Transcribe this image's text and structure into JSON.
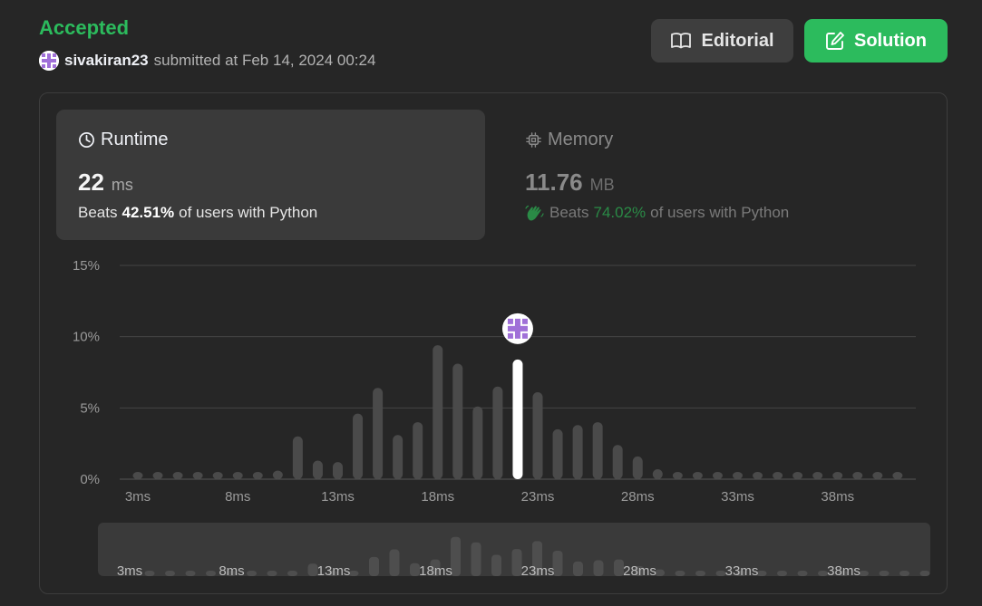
{
  "submission": {
    "status": "Accepted",
    "username": "sivakiran23",
    "submitted_text": "submitted at Feb 14, 2024 00:24"
  },
  "buttons": {
    "editorial": "Editorial",
    "solution": "Solution"
  },
  "runtime": {
    "label": "Runtime",
    "value": "22",
    "unit": "ms",
    "beats_prefix": "Beats",
    "beats_pct": "42.51%",
    "beats_suffix": "of users with Python"
  },
  "memory": {
    "label": "Memory",
    "value": "11.76",
    "unit": "MB",
    "beats_prefix": "Beats",
    "beats_pct": "74.02%",
    "beats_suffix": "of users with Python"
  },
  "colors": {
    "accent_green": "#2cbb5d",
    "bar": "#4a4a4a",
    "bar_selected": "#ffffff",
    "avatar": "#a070d8"
  },
  "chart_data": {
    "type": "bar",
    "ylabel": "",
    "xlabel": "",
    "y_ticks": [
      "15%",
      "10%",
      "5%",
      "0%"
    ],
    "ylim": [
      0,
      15
    ],
    "x_tick_labels": [
      "3ms",
      "8ms",
      "13ms",
      "18ms",
      "23ms",
      "28ms",
      "33ms",
      "38ms"
    ],
    "x": [
      3,
      4,
      5,
      6,
      7,
      8,
      9,
      10,
      11,
      12,
      13,
      14,
      15,
      16,
      17,
      18,
      19,
      20,
      21,
      22,
      23,
      24,
      25,
      26,
      27,
      28,
      29,
      30,
      31,
      32,
      33,
      34,
      35,
      36,
      37,
      38,
      39,
      40,
      41
    ],
    "values": [
      0.3,
      0.3,
      0.3,
      0.3,
      0.4,
      0.3,
      0.3,
      0.6,
      3.0,
      1.3,
      1.2,
      4.6,
      6.4,
      3.1,
      4.0,
      9.4,
      8.1,
      5.1,
      6.5,
      8.4,
      6.1,
      3.5,
      3.8,
      4.0,
      2.4,
      1.6,
      0.7,
      0.4,
      0.3,
      0.3,
      0.3,
      0.3,
      0.3,
      0.3,
      0.3,
      0.3,
      0.3,
      0.3,
      0.3
    ],
    "selected_x": 22,
    "mini_x_tick_labels": [
      "3ms",
      "8ms",
      "13ms",
      "18ms",
      "23ms",
      "28ms",
      "33ms",
      "38ms"
    ]
  }
}
